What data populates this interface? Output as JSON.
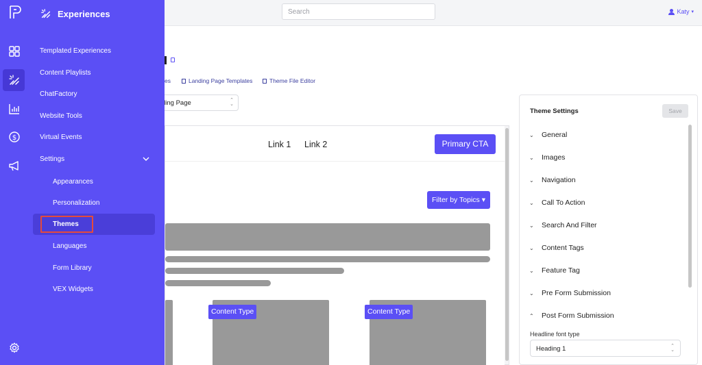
{
  "topbar": {
    "search_placeholder": "Search",
    "user_name": "Katy"
  },
  "flyout": {
    "title": "Experiences",
    "items": [
      {
        "label": "Templated Experiences"
      },
      {
        "label": "Content Playlists"
      },
      {
        "label": "ChatFactory"
      },
      {
        "label": "Website Tools"
      },
      {
        "label": "Virtual Events"
      },
      {
        "label": "Settings"
      }
    ],
    "settings_sub": [
      {
        "label": "Appearances"
      },
      {
        "label": "Personalization"
      },
      {
        "label": "Themes",
        "selected": true
      },
      {
        "label": "Languages"
      },
      {
        "label": "Form Library"
      },
      {
        "label": "VEX Widgets"
      }
    ]
  },
  "tabs": {
    "tab1": "es",
    "tab2": "Landing Page Templates",
    "tab3": "Theme File Editor"
  },
  "page_select": {
    "value": "ding Page"
  },
  "preview": {
    "link1": "Link 1",
    "link2": "Link 2",
    "primary_cta": "Primary CTA",
    "filter_button": "Filter by Topics",
    "content_type_1": "Content Type",
    "content_type_2": "Content Type"
  },
  "theme_settings": {
    "title": "Theme Settings",
    "save_label": "Save",
    "sections": [
      {
        "label": "General",
        "expanded": false
      },
      {
        "label": "Images",
        "expanded": false
      },
      {
        "label": "Navigation",
        "expanded": false
      },
      {
        "label": "Call To Action",
        "expanded": false
      },
      {
        "label": "Search And Filter",
        "expanded": false
      },
      {
        "label": "Content Tags",
        "expanded": false
      },
      {
        "label": "Feature Tag",
        "expanded": false
      },
      {
        "label": "Pre Form Submission",
        "expanded": false
      },
      {
        "label": "Post Form Submission",
        "expanded": true
      }
    ],
    "field_label": "Headline font type",
    "field_value": "Heading 1"
  },
  "colors": {
    "brand": "#5b4ff5",
    "highlight_box": "#e54a3c"
  },
  "icons": {
    "rail": [
      "logo-icon",
      "grid-icon",
      "experiences-icon",
      "analytics-icon",
      "dollar-icon",
      "megaphone-icon",
      "gear-icon"
    ]
  }
}
